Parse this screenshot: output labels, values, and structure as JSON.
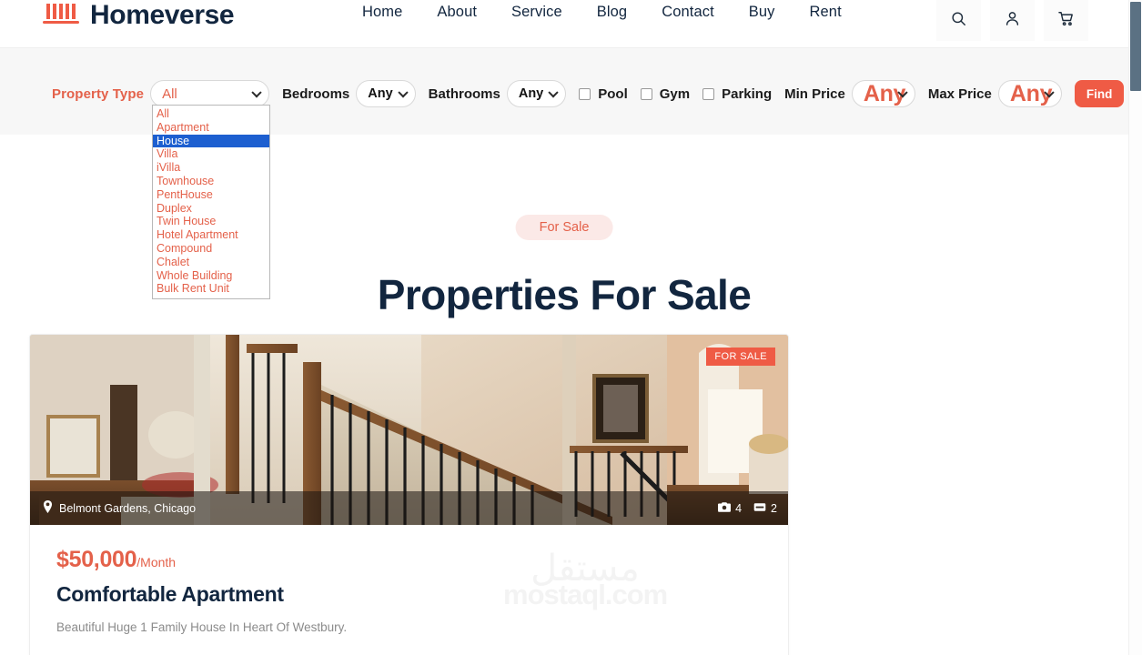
{
  "brand": {
    "name": "Homeverse",
    "logo_icon": "building-columns-icon",
    "accent_color": "#e4614a",
    "dark_color": "#12263f"
  },
  "nav": {
    "items": [
      {
        "label": "Home"
      },
      {
        "label": "About"
      },
      {
        "label": "Service"
      },
      {
        "label": "Blog"
      },
      {
        "label": "Contact"
      },
      {
        "label": "Buy"
      },
      {
        "label": "Rent"
      }
    ]
  },
  "header_icons": [
    {
      "name": "search-icon"
    },
    {
      "name": "user-icon"
    },
    {
      "name": "cart-icon"
    }
  ],
  "filters": {
    "property_type": {
      "label": "Property Type",
      "value": "All",
      "expanded": true,
      "highlighted_option": "House",
      "options": [
        "All",
        "Apartment",
        "House",
        "Villa",
        "iVilla",
        "Townhouse",
        "PentHouse",
        "Duplex",
        "Twin House",
        "Hotel Apartment",
        "Compound",
        "Chalet",
        "Whole Building",
        "Bulk Rent Unit"
      ]
    },
    "bedrooms": {
      "label": "Bedrooms",
      "value": "Any"
    },
    "bathrooms": {
      "label": "Bathrooms",
      "value": "Any"
    },
    "amenities": [
      {
        "label": "Pool",
        "checked": false
      },
      {
        "label": "Gym",
        "checked": false
      },
      {
        "label": "Parking",
        "checked": false
      }
    ],
    "min_price": {
      "label": "Min Price",
      "value": "Any"
    },
    "max_price": {
      "label": "Max Price",
      "value": "Any"
    },
    "find_button": "Find"
  },
  "hero": {
    "pill": "For Sale",
    "title": "Properties For Sale"
  },
  "listing": {
    "badge": "FOR SALE",
    "location": "Belmont Gardens, Chicago",
    "location_icon": "map-pin-icon",
    "photos_icon": "camera-icon",
    "photos_count": "4",
    "beds_icon": "bed-icon",
    "beds_count": "2",
    "price": "$50,000",
    "price_period": "/Month",
    "title": "Comfortable Apartment",
    "description": "Beautiful Huge 1 Family House In Heart Of Westbury."
  },
  "watermark": {
    "arabic": "مستقل",
    "latin": "mostaql.com"
  }
}
